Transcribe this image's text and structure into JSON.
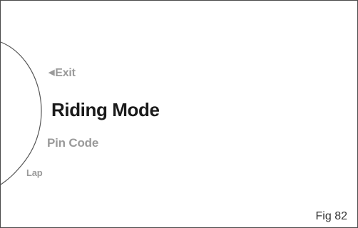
{
  "menu": {
    "back_arrow": "◀",
    "exit_label": "Exit",
    "selected_label": "Riding Mode",
    "next_label": "Pin Code",
    "next_next_label": "Lap"
  },
  "figure": {
    "caption": "Fig 82"
  },
  "colors": {
    "selected_text": "#1a1a1a",
    "dim_text": "#9a9a9a",
    "arc": "#555555",
    "frame": "#4a4a4a"
  }
}
